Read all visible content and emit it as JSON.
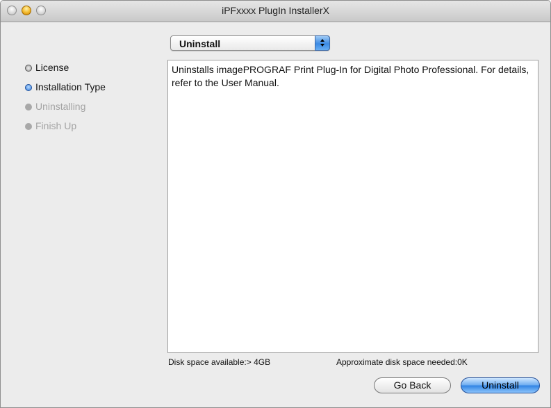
{
  "window": {
    "title": "iPFxxxx PlugIn InstallerX"
  },
  "install_type_select": {
    "value": "Uninstall"
  },
  "steps": [
    {
      "label": "License",
      "state": "done"
    },
    {
      "label": "Installation Type",
      "state": "current"
    },
    {
      "label": "Uninstalling",
      "state": "pending"
    },
    {
      "label": "Finish Up",
      "state": "pending"
    }
  ],
  "content": {
    "description": "Uninstalls imagePROGRAF Print Plug-In for Digital Photo Professional. For details, refer to the User Manual."
  },
  "disk": {
    "available": "Disk space available:> 4GB",
    "needed": "Approximate disk space needed:0K"
  },
  "buttons": {
    "back_label": "Go Back",
    "primary_label": "Uninstall"
  },
  "colors": {
    "accent": "#3b8ae4",
    "pending_text": "#a3a3a3"
  }
}
